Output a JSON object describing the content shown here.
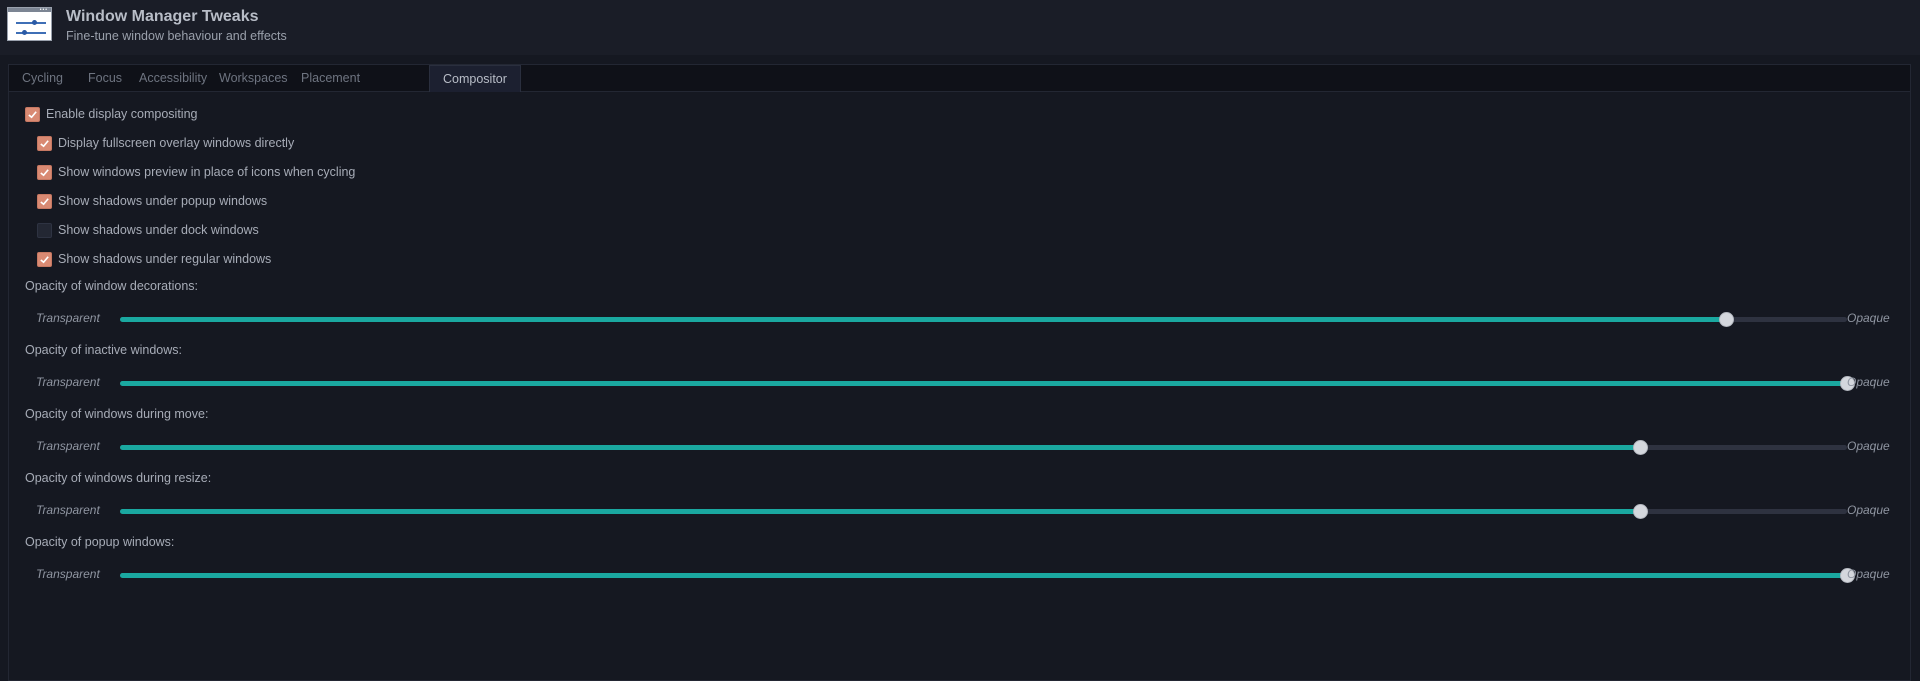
{
  "header": {
    "title": "Window Manager Tweaks",
    "subtitle": "Fine-tune window behaviour and effects",
    "icon": "window-settings-icon"
  },
  "tabs": [
    {
      "label": "Cycling",
      "active": false
    },
    {
      "label": "Focus",
      "active": false
    },
    {
      "label": "Accessibility",
      "active": false
    },
    {
      "label": "Workspaces",
      "active": false
    },
    {
      "label": "Placement",
      "active": false
    },
    {
      "label": "Compositor",
      "active": true
    }
  ],
  "compositor": {
    "enable": {
      "label": "Enable display compositing",
      "checked": true
    },
    "options": [
      {
        "label": "Display fullscreen overlay windows directly",
        "checked": true
      },
      {
        "label": "Show windows preview in place of icons when cycling",
        "checked": true
      },
      {
        "label": "Show shadows under popup windows",
        "checked": true
      },
      {
        "label": "Show shadows under dock windows",
        "checked": false
      },
      {
        "label": "Show shadows under regular windows",
        "checked": true
      }
    ],
    "scales": [
      {
        "label": "Opacity of window decorations:",
        "left": "Transparent",
        "right": "Opaque",
        "value": 0.93
      },
      {
        "label": "Opacity of inactive windows:",
        "left": "Transparent",
        "right": "Opaque",
        "value": 1.0
      },
      {
        "label": "Opacity of windows during move:",
        "left": "Transparent",
        "right": "Opaque",
        "value": 0.88
      },
      {
        "label": "Opacity of windows during resize:",
        "left": "Transparent",
        "right": "Opaque",
        "value": 0.88
      },
      {
        "label": "Opacity of popup windows:",
        "left": "Transparent",
        "right": "Opaque",
        "value": 1.0
      }
    ]
  },
  "colors": {
    "accent": "#1aa8a0",
    "checkbox_checked": "#d98a73",
    "background": "#151821"
  }
}
